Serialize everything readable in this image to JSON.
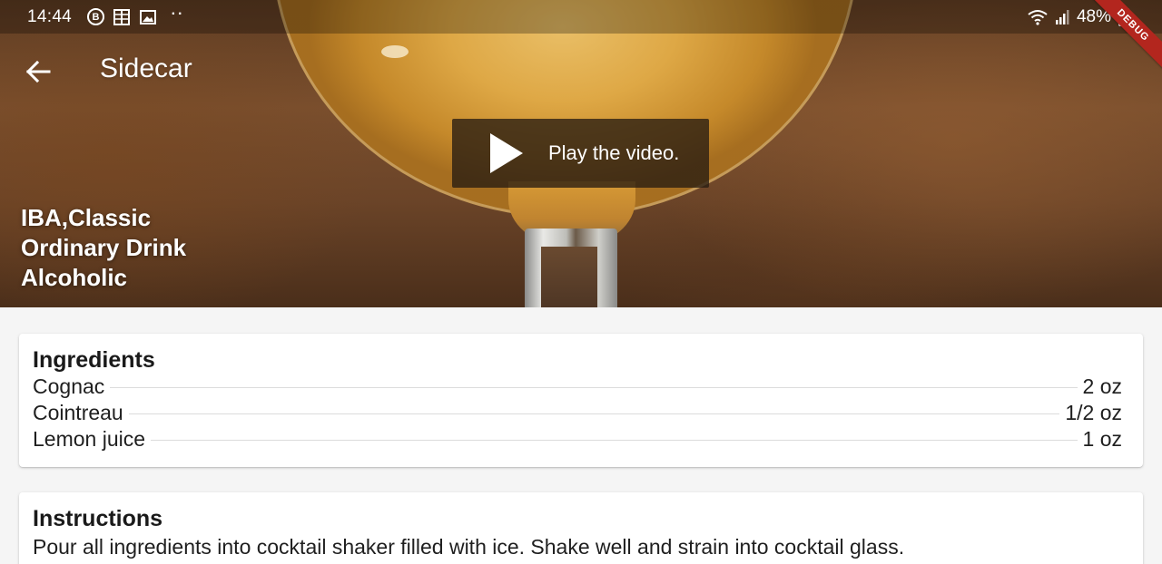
{
  "status_bar": {
    "time": "14:44",
    "notification_icons": [
      "b-circle-icon",
      "grid-icon",
      "image-icon",
      "more-dots-icon"
    ],
    "battery_percent": "48%"
  },
  "debug_banner": "DEBUG",
  "app_bar": {
    "title": "Sidecar"
  },
  "video": {
    "label": "Play the video."
  },
  "tags": {
    "tag_line": "IBA,Classic",
    "category": "Ordinary Drink",
    "alcoholic": "Alcoholic"
  },
  "ingredients": {
    "heading": "Ingredients",
    "items": [
      {
        "name": "Cognac",
        "measure": "2 oz"
      },
      {
        "name": "Cointreau",
        "measure": "1/2 oz"
      },
      {
        "name": "Lemon juice",
        "measure": "1 oz"
      }
    ]
  },
  "instructions": {
    "heading": "Instructions",
    "text": "Pour all ingredients into cocktail shaker filled with ice. Shake well and strain into cocktail glass."
  },
  "colors": {
    "debug_banner": "#b3261e",
    "page_background": "#f5f5f5",
    "card_background": "#ffffff"
  }
}
